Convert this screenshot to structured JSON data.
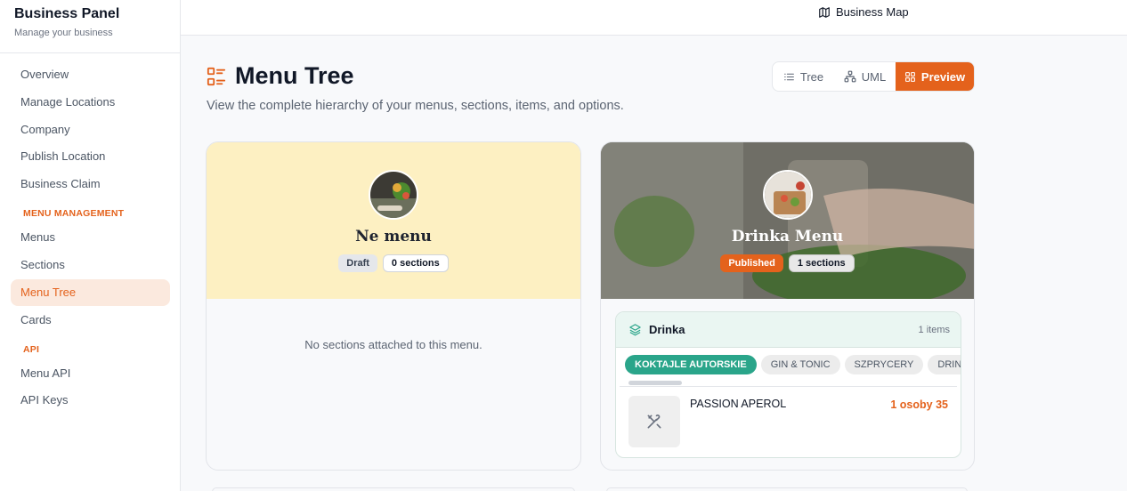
{
  "brand": {
    "title": "Business Panel",
    "subtitle": "Manage your business"
  },
  "nav": {
    "items_top": [
      "Overview",
      "Manage Locations",
      "Company",
      "Publish Location",
      "Business Claim"
    ],
    "menu_heading": "MENU MANAGEMENT",
    "menu_items": [
      "Menus",
      "Sections",
      "Menu Tree",
      "Cards"
    ],
    "active": "Menu Tree",
    "api_heading": "API",
    "api_items": [
      "Menu API",
      "API Keys"
    ]
  },
  "topbar": {
    "map_link": "Business Map"
  },
  "page": {
    "title": "Menu Tree",
    "description": "View the complete hierarchy of your menus, sections, items, and options."
  },
  "view_switch": {
    "tree": "Tree",
    "uml": "UML",
    "preview": "Preview",
    "active": "Preview"
  },
  "menus": [
    {
      "name": "Ne menu",
      "status": "Draft",
      "sections_count": "0 sections",
      "empty_text": "No sections attached to this menu."
    },
    {
      "name": "Drinka Menu",
      "status": "Published",
      "sections_count": "1 sections",
      "section": {
        "name": "Drinka",
        "items_count": "1 items",
        "chips": [
          "KOKTAJLE AUTORSKIE",
          "GIN & TONIC",
          "SZPRYCERY",
          "DRINKS"
        ],
        "active_chip": "KOKTAJLE AUTORSKIE",
        "item": {
          "name": "PASSION APEROL",
          "price": "1 osoby 35"
        }
      }
    }
  ],
  "colors": {
    "accent": "#e4621c",
    "teal": "#2aa58a",
    "draft_bg": "#fdf0c2"
  }
}
